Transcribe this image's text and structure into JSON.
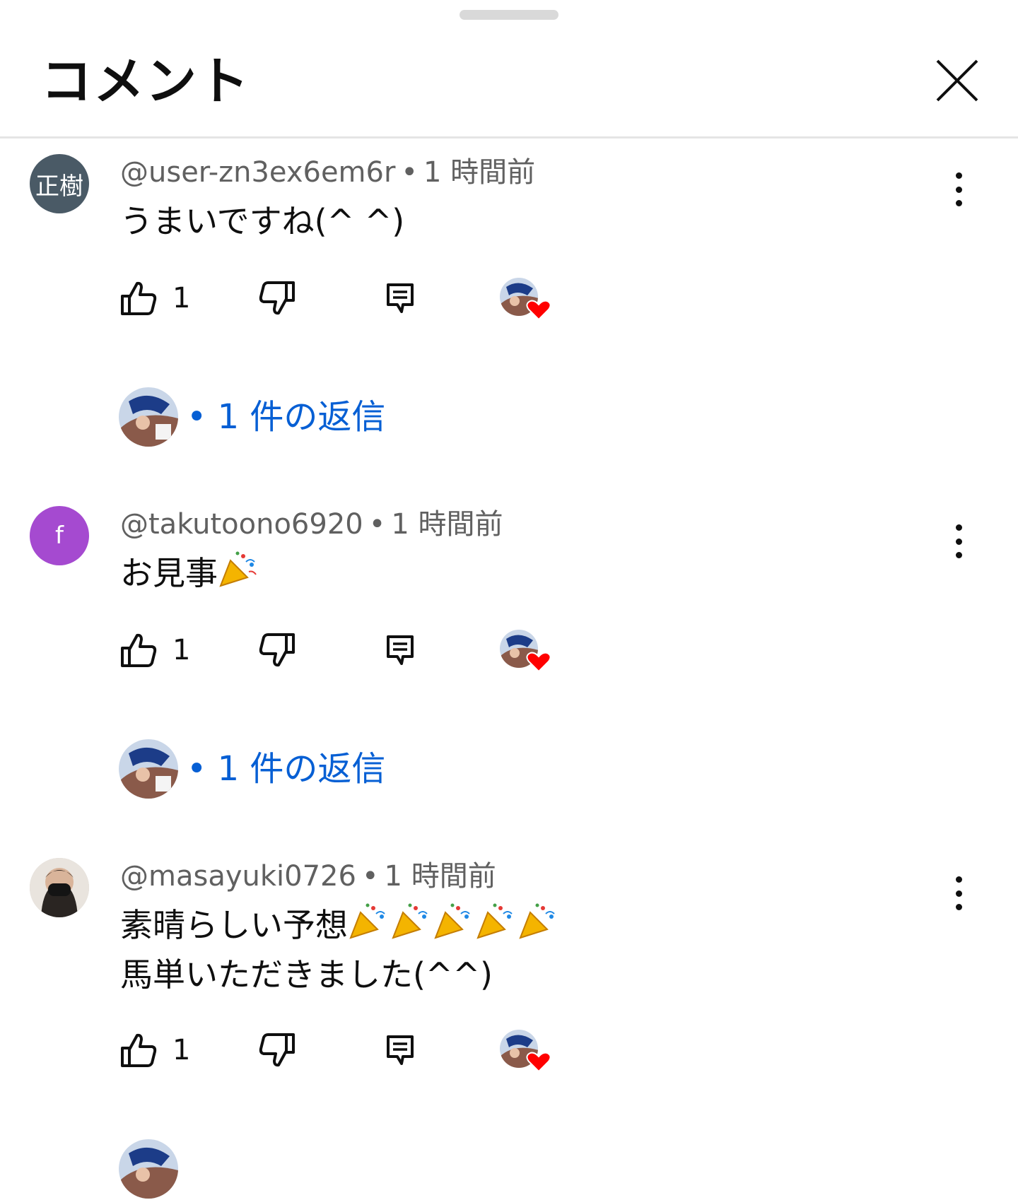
{
  "header": {
    "title": "コメント"
  },
  "comments": [
    {
      "avatar_text": "正樹",
      "avatar_color": "#4a5a66",
      "author": "@user-zn3ex6em6r",
      "time": "1 時間前",
      "text": "うまいですね(^ ^)",
      "text_emoji_count": 0,
      "likes": "1",
      "replies_label": "1 件の返信"
    },
    {
      "avatar_text": "f",
      "avatar_color": "#a54ad0",
      "author": "@takutoono6920",
      "time": "1 時間前",
      "text": "お見事",
      "text_emoji_count": 1,
      "likes": "1",
      "replies_label": "1 件の返信"
    },
    {
      "avatar_text": "",
      "avatar_color": "#cfc6bd",
      "author": "@masayuki0726",
      "time": "1 時間前",
      "text_line1": "素晴らしい予想",
      "text_emoji_count": 5,
      "text_line2": "馬単いただきました(^^)",
      "likes": "1"
    }
  ],
  "separator": "•",
  "colors": {
    "link": "#065fd4",
    "meta": "#606060",
    "heart": "#ff0000"
  },
  "icons": [
    "close-icon",
    "more-vert-icon",
    "thumb-up-icon",
    "thumb-down-icon",
    "reply-icon",
    "creator-heart-icon",
    "party-popper-emoji"
  ]
}
